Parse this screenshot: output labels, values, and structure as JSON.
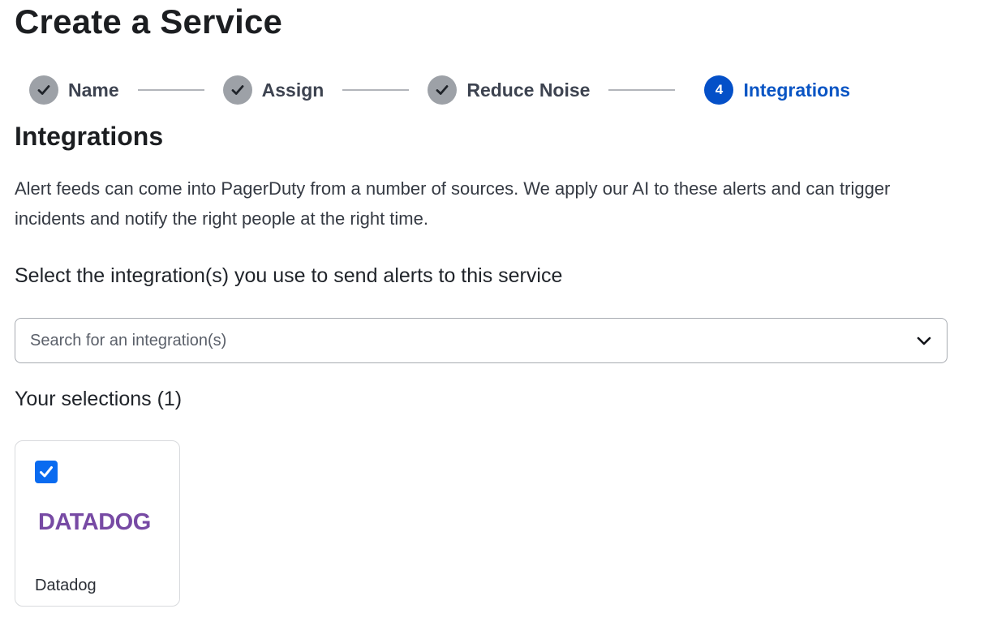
{
  "page_title": "Create a Service",
  "stepper": {
    "steps": [
      {
        "label": "Name",
        "state": "complete",
        "icon": "check-icon"
      },
      {
        "label": "Assign",
        "state": "complete",
        "icon": "check-icon"
      },
      {
        "label": "Reduce Noise",
        "state": "complete",
        "icon": "check-icon"
      },
      {
        "label": "Integrations",
        "state": "active",
        "number": "4"
      }
    ]
  },
  "section": {
    "title": "Integrations",
    "description": "Alert feeds can come into PagerDuty from a number of sources. We apply our AI to these alerts and can trigger incidents and notify the right people at the right time.",
    "select_heading": "Select the integration(s) you use to send alerts to this service"
  },
  "search": {
    "placeholder": "Search for an integration(s)",
    "value": "",
    "icon": "chevron-down-icon"
  },
  "selections": {
    "heading": "Your selections (1)",
    "items": [
      {
        "logo_text": "DATADOG",
        "name": "Datadog",
        "checked": true
      }
    ]
  },
  "colors": {
    "active_step": "#0450c8",
    "complete_step": "#9da1a7",
    "checkbox": "#0a6bf0",
    "datadog_brand": "#774aa4"
  }
}
